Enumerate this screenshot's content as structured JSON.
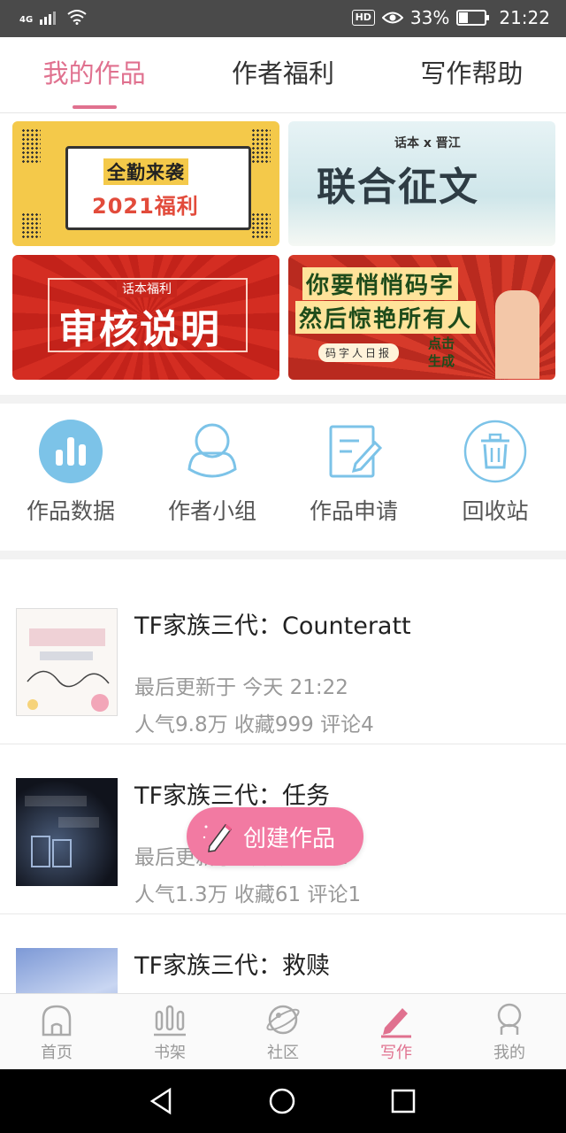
{
  "status_bar": {
    "network": "4G",
    "hd": "HD",
    "battery_percent": "33%",
    "battery_level": 0.33,
    "time": "21:22"
  },
  "top_tabs": [
    {
      "label": "我的作品",
      "active": true
    },
    {
      "label": "作者福利",
      "active": false
    },
    {
      "label": "写作帮助",
      "active": false
    }
  ],
  "banners": {
    "welfare": {
      "line1": "全勤来袭",
      "line2": "2021福利"
    },
    "contest": {
      "tag": "话本 x 晋江",
      "title": "联合征文"
    },
    "review": {
      "small": "话本福利",
      "title": "审核说明"
    },
    "daily": {
      "line1": "你要悄悄码字",
      "line2": "然后惊艳所有人",
      "pill": "码字人日报",
      "click": "点击生成"
    }
  },
  "tools": [
    {
      "label": "作品数据",
      "icon": "bar-chart-icon"
    },
    {
      "label": "作者小组",
      "icon": "group-icon"
    },
    {
      "label": "作品申请",
      "icon": "edit-form-icon"
    },
    {
      "label": "回收站",
      "icon": "trash-icon"
    }
  ],
  "works": [
    {
      "title": "TF家族三代：Counteratt",
      "updated": "最后更新于 今天 21:22",
      "stats": "人气9.8万 收藏999 评论4"
    },
    {
      "title": "TF家族三代：任务",
      "updated": "最后更新于 今天 21:22",
      "stats": "人气1.3万 收藏61 评论1"
    },
    {
      "title": "TF家族三代：救赎",
      "updated": "",
      "stats": ""
    }
  ],
  "fab": {
    "label": "创建作品",
    "icon": "pencil-icon"
  },
  "tabbar": [
    {
      "label": "首页",
      "icon": "home-icon",
      "active": false
    },
    {
      "label": "书架",
      "icon": "bookshelf-icon",
      "active": false
    },
    {
      "label": "社区",
      "icon": "planet-icon",
      "active": false
    },
    {
      "label": "写作",
      "icon": "pen-icon",
      "active": true
    },
    {
      "label": "我的",
      "icon": "profile-icon",
      "active": false
    }
  ],
  "colors": {
    "accent": "#e0718f",
    "fab": "#f27aa2",
    "tool_icon": "#7cc3e8"
  }
}
